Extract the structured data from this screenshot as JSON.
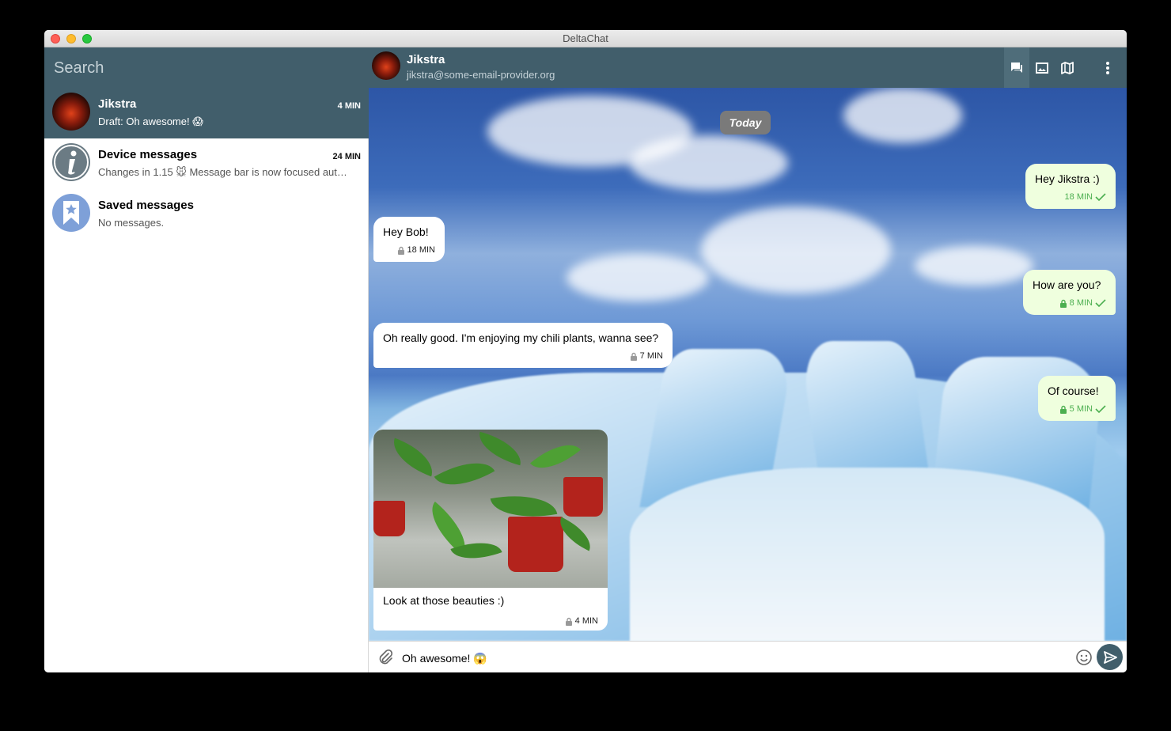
{
  "window": {
    "title": "DeltaChat"
  },
  "search": {
    "placeholder": "Search"
  },
  "chats": [
    {
      "name": "Jikstra",
      "time": "4 MIN",
      "preview": "Draft: Oh awesome! 😱",
      "avatar": "photo-avatar",
      "selected": true
    },
    {
      "name": "Device messages",
      "time": "24 MIN",
      "preview": "Changes in 1.15 🐭 Message bar is now focused automatically",
      "avatar": "info-icon",
      "selected": false
    },
    {
      "name": "Saved messages",
      "time": "",
      "preview": "No messages.",
      "avatar": "bookmark-star-icon",
      "selected": false
    }
  ],
  "header": {
    "name": "Jikstra",
    "address": "jikstra@some-email-provider.org",
    "buttons": [
      "chat-view-icon",
      "gallery-icon",
      "map-icon",
      "more-vert-icon"
    ]
  },
  "conversation": {
    "day_marker": "Today",
    "messages": [
      {
        "direction": "out",
        "text": "Hey Jikstra :)",
        "time": "18 MIN",
        "encrypted": false,
        "delivered": true
      },
      {
        "direction": "in",
        "text": "Hey Bob!",
        "time": "18 MIN",
        "encrypted": true
      },
      {
        "direction": "out",
        "text": "How are you?",
        "time": "8 MIN",
        "encrypted": true,
        "delivered": true
      },
      {
        "direction": "in",
        "text": "Oh really good. I'm enjoying my chili plants, wanna see?",
        "time": "7 MIN",
        "encrypted": true
      },
      {
        "direction": "out",
        "text": "Of course!",
        "time": "5 MIN",
        "encrypted": true,
        "delivered": true
      },
      {
        "direction": "in",
        "text": "Look at those beauties :)",
        "time": "4 MIN",
        "encrypted": true,
        "image": "chili-plants-photo"
      }
    ]
  },
  "composer": {
    "value": "Oh awesome! 😱"
  },
  "colors": {
    "header": "#415e6b",
    "outgoing_bubble": "#efffde",
    "incoming_bubble": "#ffffff",
    "check": "#4caf50",
    "day_marker": "#7a7a7a"
  }
}
